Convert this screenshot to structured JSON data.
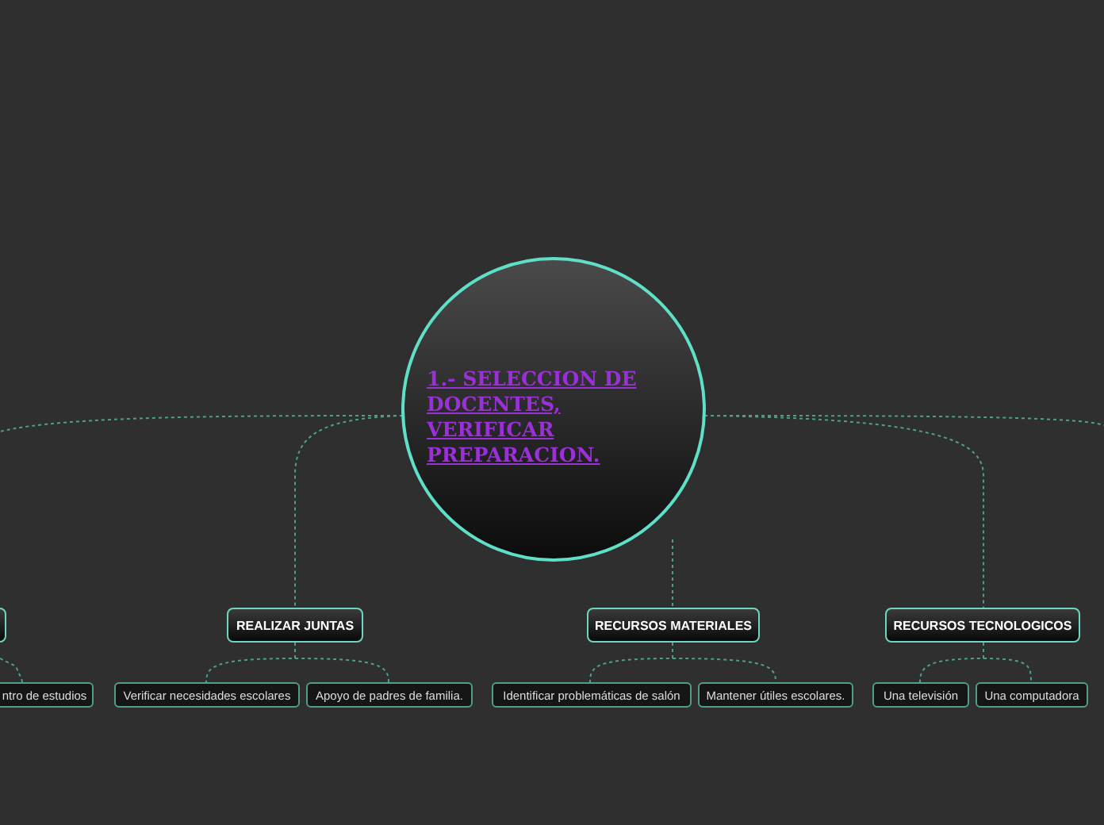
{
  "center": {
    "title": "1.- SELECCION DE DOCENTES, VERIFICAR PREPARACION."
  },
  "branches": [
    {
      "kind": "partial",
      "children": [
        {
          "label": "ntro de estudios"
        }
      ]
    },
    {
      "kind": "node",
      "label": "REALIZAR JUNTAS",
      "children": [
        {
          "label": "Verificar necesidades escolares"
        },
        {
          "label": "Apoyo de padres de familia."
        }
      ]
    },
    {
      "kind": "node",
      "label": "RECURSOS MATERIALES",
      "children": [
        {
          "label": "Identificar problemáticas de salón"
        },
        {
          "label": "Mantener útiles escolares."
        }
      ]
    },
    {
      "kind": "node",
      "label": "RECURSOS TECNOLOGICOS",
      "children": [
        {
          "label": "Una televisión"
        },
        {
          "label": "Una computadora"
        }
      ]
    }
  ]
}
